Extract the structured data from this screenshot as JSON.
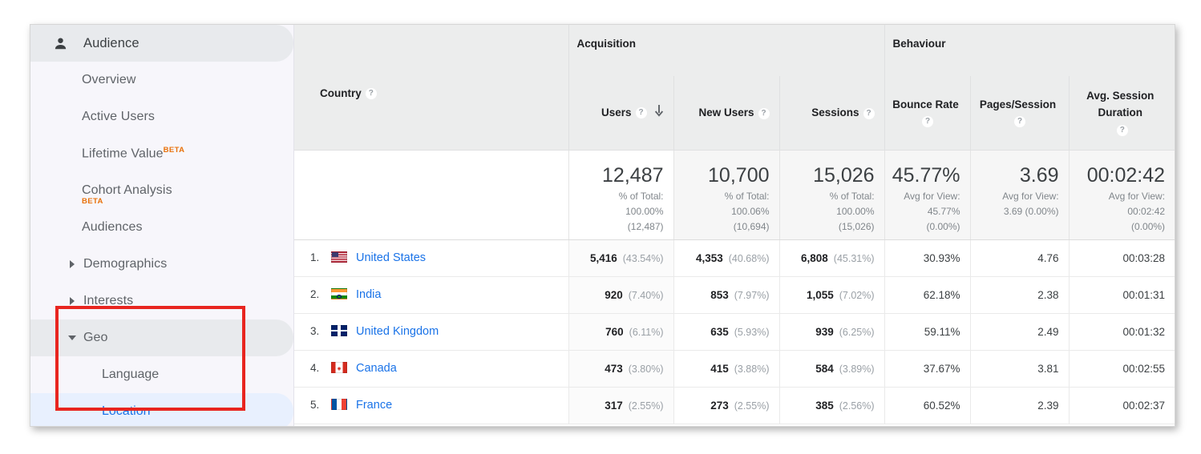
{
  "sidebar": {
    "header": {
      "label": "Audience",
      "icon": "person-icon"
    },
    "items": [
      {
        "label": "Overview",
        "type": "item"
      },
      {
        "label": "Active Users",
        "type": "item"
      },
      {
        "label": "Lifetime Value",
        "badge": "BETA",
        "badge_pos": "sup",
        "type": "item"
      },
      {
        "label": "Cohort Analysis",
        "badge": "BETA",
        "badge_pos": "below",
        "type": "item"
      },
      {
        "label": "Audiences",
        "type": "item"
      },
      {
        "label": "Demographics",
        "type": "parent",
        "expanded": false,
        "caret": "chevron-right-icon"
      },
      {
        "label": "Interests",
        "type": "parent",
        "expanded": false,
        "caret": "chevron-right-icon"
      },
      {
        "label": "Geo",
        "type": "parent",
        "expanded": true,
        "caret": "chevron-down-icon"
      },
      {
        "label": "Language",
        "type": "child",
        "selected": false
      },
      {
        "label": "Location",
        "type": "child",
        "selected": true
      }
    ],
    "annotation": {
      "type": "red-highlight-box",
      "color": "#e8251f",
      "surrounds": [
        "Geo",
        "Language",
        "Location"
      ]
    }
  },
  "colors": {
    "link_blue": "#1a73e8",
    "selected_bg": "#e8f0fe",
    "active_bg": "#e8eaed",
    "beta_orange": "#e8710a",
    "annotation_red": "#e8251f"
  },
  "table": {
    "dimension_header": {
      "label": "Country",
      "help": "?"
    },
    "groups": [
      {
        "label": "Acquisition",
        "span": 3
      },
      {
        "label": "Behaviour",
        "span": 3
      }
    ],
    "metrics": [
      {
        "label": "Users",
        "help": "?",
        "sorted": true,
        "sort_dir": "descending",
        "sort_icon": "arrow-down-icon"
      },
      {
        "label": "New Users",
        "help": "?",
        "sorted": false
      },
      {
        "label": "Sessions",
        "help": "?",
        "sorted": false
      },
      {
        "label": "Bounce Rate",
        "help": "?",
        "sorted": false
      },
      {
        "label": "Pages/Session",
        "help": "?",
        "sorted": false
      },
      {
        "label": "Avg. Session Duration",
        "help": "?",
        "sorted": false
      }
    ],
    "summary": [
      {
        "value": "12,487",
        "sub1": "% of Total:",
        "sub2": "100.00%",
        "sub3": "(12,487)"
      },
      {
        "value": "10,700",
        "sub1": "% of Total:",
        "sub2": "100.06%",
        "sub3": "(10,694)"
      },
      {
        "value": "15,026",
        "sub1": "% of Total:",
        "sub2": "100.00%",
        "sub3": "(15,026)"
      },
      {
        "value": "45.77%",
        "sub1": "Avg for View:",
        "sub2": "45.77%",
        "sub3": "(0.00%)"
      },
      {
        "value": "3.69",
        "sub1": "Avg for View:",
        "sub2": "3.69 (0.00%)",
        "sub3": ""
      },
      {
        "value": "00:02:42",
        "sub1": "Avg for View:",
        "sub2": "00:02:42",
        "sub3": "(0.00%)"
      }
    ],
    "rows": [
      {
        "rank": "1.",
        "country": "United States",
        "flag": "flag-us",
        "users": "5,416",
        "users_pct": "(43.54%)",
        "new_users": "4,353",
        "new_users_pct": "(40.68%)",
        "sessions": "6,808",
        "sessions_pct": "(45.31%)",
        "bounce_rate": "30.93%",
        "pages_session": "4.76",
        "avg_duration": "00:03:28"
      },
      {
        "rank": "2.",
        "country": "India",
        "flag": "flag-in",
        "users": "920",
        "users_pct": "(7.40%)",
        "new_users": "853",
        "new_users_pct": "(7.97%)",
        "sessions": "1,055",
        "sessions_pct": "(7.02%)",
        "bounce_rate": "62.18%",
        "pages_session": "2.38",
        "avg_duration": "00:01:31"
      },
      {
        "rank": "3.",
        "country": "United Kingdom",
        "flag": "flag-gb",
        "users": "760",
        "users_pct": "(6.11%)",
        "new_users": "635",
        "new_users_pct": "(5.93%)",
        "sessions": "939",
        "sessions_pct": "(6.25%)",
        "bounce_rate": "59.11%",
        "pages_session": "2.49",
        "avg_duration": "00:01:32"
      },
      {
        "rank": "4.",
        "country": "Canada",
        "flag": "flag-ca",
        "users": "473",
        "users_pct": "(3.80%)",
        "new_users": "415",
        "new_users_pct": "(3.88%)",
        "sessions": "584",
        "sessions_pct": "(3.89%)",
        "bounce_rate": "37.67%",
        "pages_session": "3.81",
        "avg_duration": "00:02:55"
      },
      {
        "rank": "5.",
        "country": "France",
        "flag": "flag-fr",
        "users": "317",
        "users_pct": "(2.55%)",
        "new_users": "273",
        "new_users_pct": "(2.55%)",
        "sessions": "385",
        "sessions_pct": "(2.56%)",
        "bounce_rate": "60.52%",
        "pages_session": "2.39",
        "avg_duration": "00:02:37"
      }
    ]
  }
}
